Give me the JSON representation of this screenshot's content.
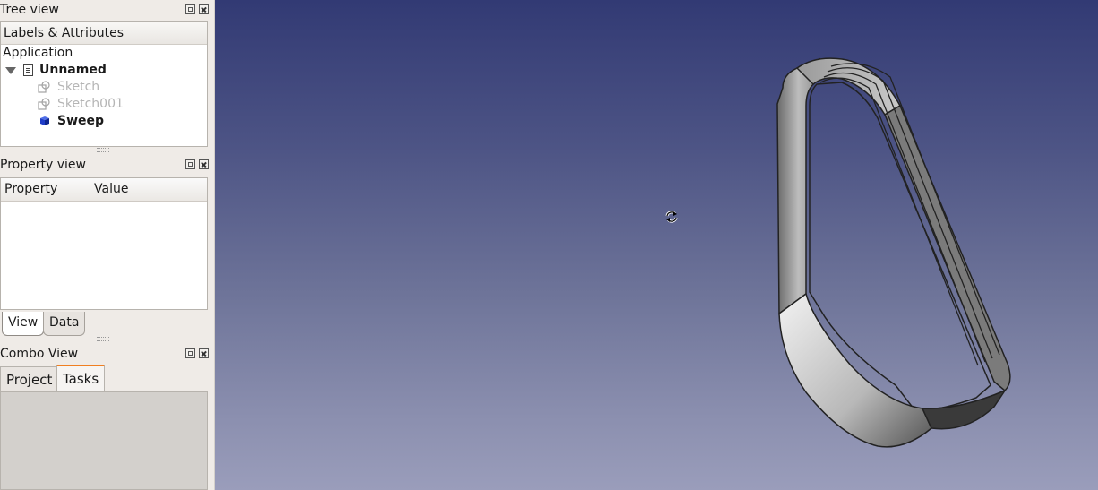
{
  "tree_view": {
    "title": "Tree view",
    "header": "Labels & Attributes",
    "application_label": "Application",
    "items": [
      {
        "label": "Unnamed",
        "icon": "document-icon",
        "state": "expanded"
      },
      {
        "label": "Sketch",
        "icon": "sketch-icon",
        "state": "hidden"
      },
      {
        "label": "Sketch001",
        "icon": "sketch-icon",
        "state": "hidden"
      },
      {
        "label": "Sweep",
        "icon": "solid-cube-icon",
        "state": "visible"
      }
    ]
  },
  "property_view": {
    "title": "Property view",
    "columns": [
      "Property",
      "Value"
    ],
    "tabs": [
      {
        "label": "View",
        "active": true
      },
      {
        "label": "Data",
        "active": false
      }
    ]
  },
  "combo_view": {
    "title": "Combo View",
    "tabs": [
      {
        "label": "Project",
        "active": false
      },
      {
        "label": "Tasks",
        "active": true
      }
    ]
  },
  "colors": {
    "viewport_top": "#323a74",
    "viewport_bottom": "#9a9dbb",
    "active_tab_accent": "#f07f21",
    "solid_icon": "#1f3cc8"
  },
  "viewport": {
    "cursor": "rotate-cursor-icon",
    "model": "sweep-solid"
  }
}
